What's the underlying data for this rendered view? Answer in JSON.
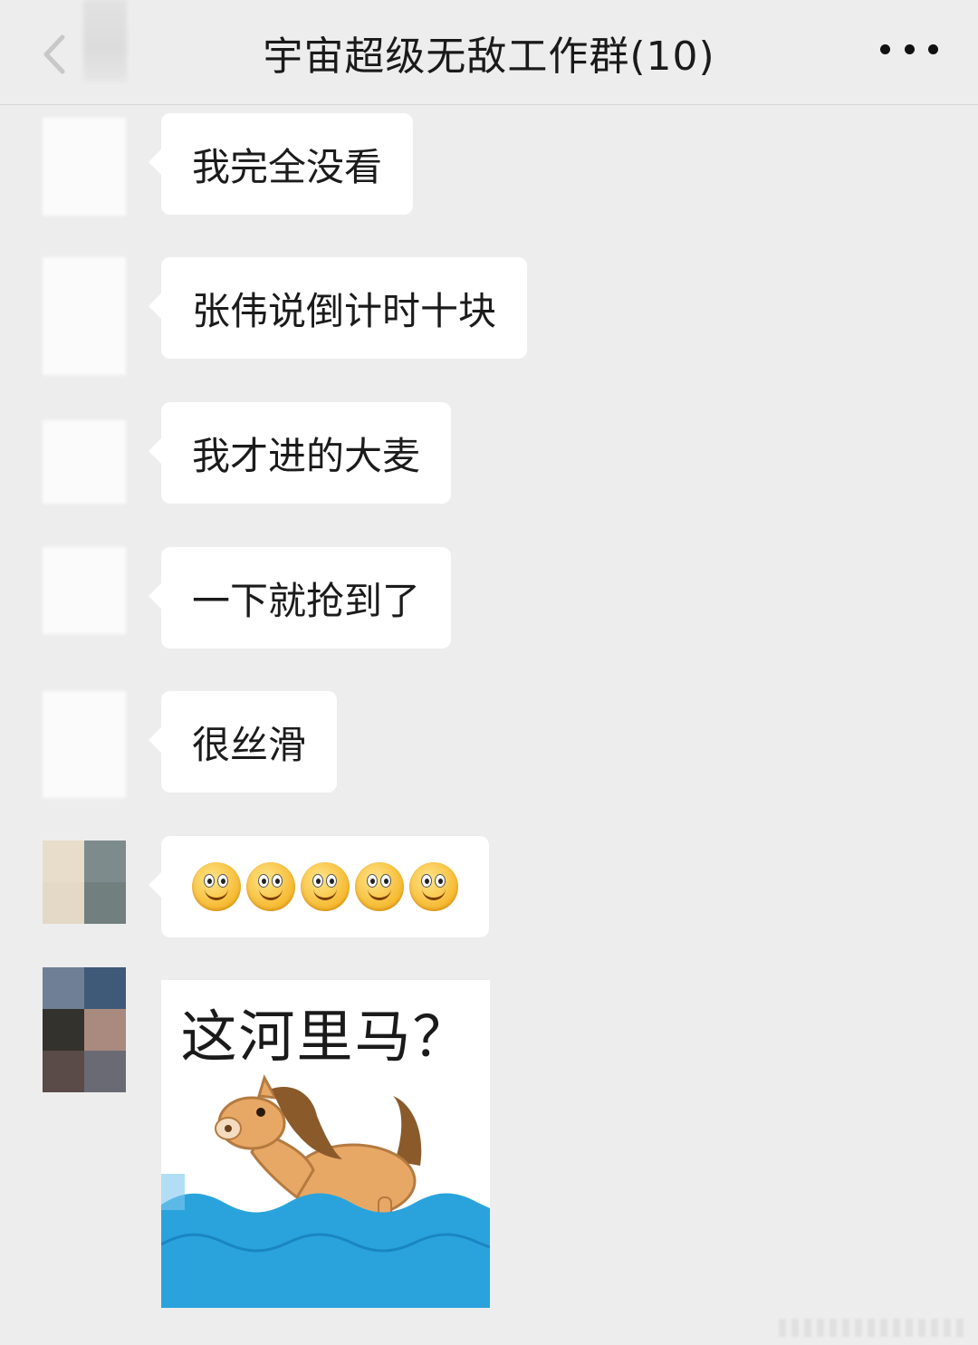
{
  "header": {
    "title": "宇宙超级无敌工作群(10)",
    "back_icon": "back-arrow-icon",
    "more_icon": "more-dots-icon"
  },
  "messages": [
    {
      "text": "我完全没看"
    },
    {
      "text": "张伟说倒计时十块"
    },
    {
      "text": "我才进的大麦"
    },
    {
      "text": "一下就抢到了"
    },
    {
      "text": "很丝滑"
    },
    {
      "emoji": "smile-emoji",
      "count": 5
    },
    {
      "sticker": {
        "caption": "这河里马？",
        "image": "horse-in-water"
      }
    }
  ],
  "colors": {
    "background": "#ededed",
    "bubble": "#ffffff",
    "water": "#2aa3dc",
    "horse": "#e8a865"
  }
}
